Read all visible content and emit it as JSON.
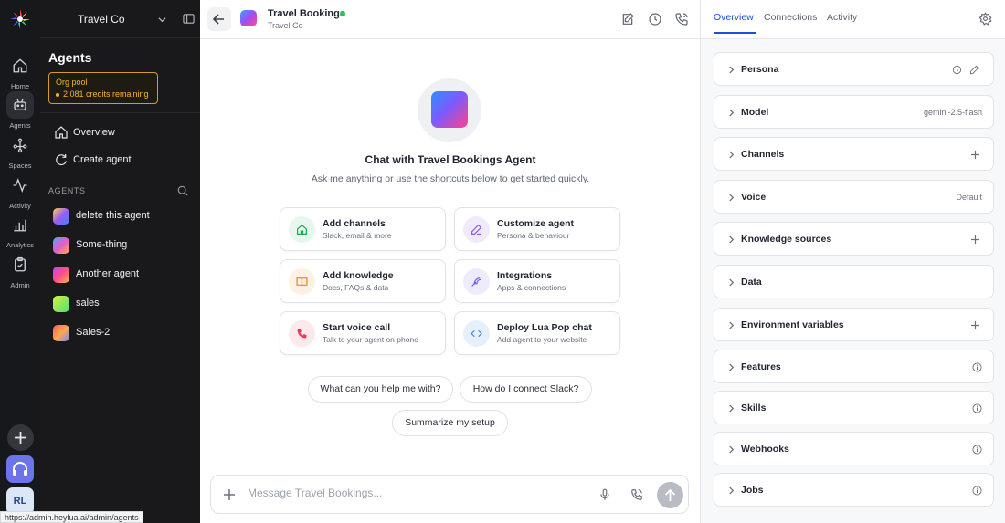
{
  "rail": {
    "items": [
      {
        "label": "Home",
        "icon": "home-icon"
      },
      {
        "label": "Agents",
        "icon": "bot-icon",
        "active": true
      },
      {
        "label": "Spaces",
        "icon": "spaces-icon"
      },
      {
        "label": "Activity",
        "icon": "activity-icon"
      },
      {
        "label": "Analytics",
        "icon": "analytics-icon"
      },
      {
        "label": "Admin",
        "icon": "clipboard-icon"
      }
    ],
    "avatar_initials": "RL"
  },
  "sidebar": {
    "org_name": "Travel Co",
    "heading": "Agents",
    "pool": {
      "title": "Org pool",
      "credits": "2,081 credits remaining"
    },
    "nav": [
      {
        "label": "Overview",
        "icon": "home-icon"
      },
      {
        "label": "Create agent",
        "icon": "create-icon"
      }
    ],
    "section_label": "AGENTS",
    "agents": [
      {
        "name": "delete this agent",
        "gradient": "linear-gradient(135deg,#ffd34d,#9b5cf6,#3b82f6)"
      },
      {
        "name": "Some-thing",
        "gradient": "linear-gradient(135deg,#4fa7ff,#e25cc8,#ffb347)"
      },
      {
        "name": "Another agent",
        "gradient": "linear-gradient(135deg,#b44cf0,#ff4d8d,#ffb547)"
      },
      {
        "name": "sales",
        "gradient": "linear-gradient(135deg,#d9f23a,#4ade80)"
      },
      {
        "name": "Sales-2",
        "gradient": "linear-gradient(135deg,#ff5a5a,#ffa94d,#6c8cff)"
      }
    ]
  },
  "header": {
    "title": "Travel Bookings",
    "subtitle": "Travel Co",
    "status_color": "#22c55e"
  },
  "main": {
    "title": "Chat with Travel Bookings Agent",
    "subtitle": "Ask me anything or use the shortcuts below to get started quickly.",
    "cards": [
      {
        "title": "Add channels",
        "subtitle": "Slack, email & more",
        "icon": "house-icon",
        "bg": "#e8f7ee",
        "color": "#22a55a"
      },
      {
        "title": "Customize agent",
        "subtitle": "Persona & behaviour",
        "icon": "pen-icon",
        "bg": "#f1eafd",
        "color": "#8b5cf6"
      },
      {
        "title": "Add knowledge",
        "subtitle": "Docs, FAQs & data",
        "icon": "book-icon",
        "bg": "#fdf1e3",
        "color": "#e0891f"
      },
      {
        "title": "Integrations",
        "subtitle": "Apps & connections",
        "icon": "plug-icon",
        "bg": "#eeebfd",
        "color": "#6d5ce8"
      },
      {
        "title": "Start voice call",
        "subtitle": "Talk to your agent on phone",
        "icon": "phone-icon",
        "bg": "#fde8ec",
        "color": "#e53956"
      },
      {
        "title": "Deploy Lua Pop chat",
        "subtitle": "Add agent to your website",
        "icon": "code-icon",
        "bg": "#e6f0fd",
        "color": "#3b82f6"
      }
    ],
    "chips": [
      "What can you help me with?",
      "How do I connect Slack?",
      "Summarize my setup"
    ],
    "composer_placeholder": "Message Travel Bookings..."
  },
  "status_url": "https://admin.heylua.ai/admin/agents",
  "panel": {
    "tabs": [
      "Overview",
      "Connections",
      "Activity"
    ],
    "sections": [
      {
        "title": "Persona",
        "value": "",
        "action": "history-edit"
      },
      {
        "title": "Model",
        "value": "gemini-2.5-flash",
        "action": "value"
      },
      {
        "title": "Channels",
        "value": "",
        "action": "plus"
      },
      {
        "title": "Voice",
        "value": "Default",
        "action": "value"
      },
      {
        "title": "Knowledge sources",
        "value": "",
        "action": "plus"
      },
      {
        "title": "Data",
        "value": "",
        "action": "none"
      },
      {
        "title": "Environment variables",
        "value": "",
        "action": "plus"
      },
      {
        "title": "Features",
        "value": "",
        "action": "info"
      },
      {
        "title": "Skills",
        "value": "",
        "action": "info"
      },
      {
        "title": "Webhooks",
        "value": "",
        "action": "info"
      },
      {
        "title": "Jobs",
        "value": "",
        "action": "info"
      }
    ]
  }
}
